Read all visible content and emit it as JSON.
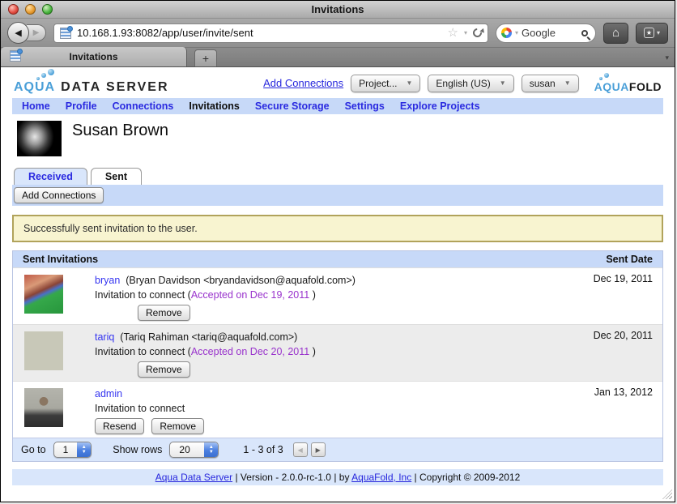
{
  "window": {
    "title": "Invitations"
  },
  "browser": {
    "url": "10.168.1.93:8082/app/user/invite/sent",
    "search_text": "Google",
    "tab_title": "Invitations",
    "favicon": "data-grid-icon"
  },
  "icons": {
    "back_arrow": "◀",
    "forward_arrow": "▶",
    "star_outline": "☆",
    "dropdown_arrow": "▼",
    "small_down": "▾",
    "home": "⌂",
    "bookmark_star": "★",
    "plus": "+",
    "up": "▲",
    "down": "▼",
    "left": "◀",
    "right": "▶"
  },
  "header": {
    "logo_aqua": "AQUA",
    "logo_rest": "DATA SERVER",
    "add_connections_link": "Add Connections",
    "project_dropdown": "Project...",
    "language_dropdown": "English (US)",
    "user_dropdown": "susan",
    "aquafold_aqua": "AQUA",
    "aquafold_fold": "FOLD"
  },
  "nav": {
    "items": [
      {
        "label": "Home",
        "active": false
      },
      {
        "label": "Profile",
        "active": false
      },
      {
        "label": "Connections",
        "active": false
      },
      {
        "label": "Invitations",
        "active": true
      },
      {
        "label": "Secure Storage",
        "active": false
      },
      {
        "label": "Settings",
        "active": false
      },
      {
        "label": "Explore Projects",
        "active": false
      }
    ]
  },
  "profile": {
    "name": "Susan Brown"
  },
  "tabs": {
    "received": "Received",
    "sent": "Sent"
  },
  "toolbar": {
    "add_connections_label": "Add Connections"
  },
  "message": {
    "text": "Successfully sent invitation to the user."
  },
  "table": {
    "header": {
      "left": "Sent Invitations",
      "right": "Sent Date"
    },
    "rows": [
      {
        "username": "bryan",
        "details": "(Bryan Davidson <bryandavidson@aquafold.com>)",
        "invitation_prefix": "Invitation to connect (",
        "accepted": "Accepted on Dec 19, 2011",
        "invitation_suffix": " )",
        "buttons": [
          "Remove"
        ],
        "date": "Dec 19, 2011"
      },
      {
        "username": "tariq",
        "details": "(Tariq Rahiman <tariq@aquafold.com>)",
        "invitation_prefix": "Invitation to connect (",
        "accepted": "Accepted on Dec 20, 2011",
        "invitation_suffix": " )",
        "buttons": [
          "Remove"
        ],
        "date": "Dec 20, 2011"
      },
      {
        "username": "admin",
        "details": "",
        "invitation_prefix": "Invitation to connect",
        "buttons": [
          "Resend",
          "Remove"
        ],
        "date": "Jan 13, 2012"
      }
    ]
  },
  "pagination": {
    "goto_label": "Go to",
    "goto_value": "1",
    "show_rows_label": "Show rows",
    "show_rows_value": "20",
    "range": "1 - 3 of 3"
  },
  "footer": {
    "link_site": "Aqua Data Server",
    "separator": "|",
    "version_text": "Version - 2.0.0-rc-1.0",
    "by_text": "by",
    "link_company": "AquaFold, Inc",
    "copyright": "Copyright © 2009-2012"
  },
  "colors": {
    "accent_blue_bar": "#c7d9f8",
    "accent_blue_light": "#d9e6fb",
    "link_blue": "#2a2ae0",
    "accepted_purple": "#9933cc",
    "message_bg": "#f8f4d0",
    "message_border": "#b1a35b",
    "alt_row": "#ececec",
    "brand_aqua": "#4a9fd8"
  }
}
